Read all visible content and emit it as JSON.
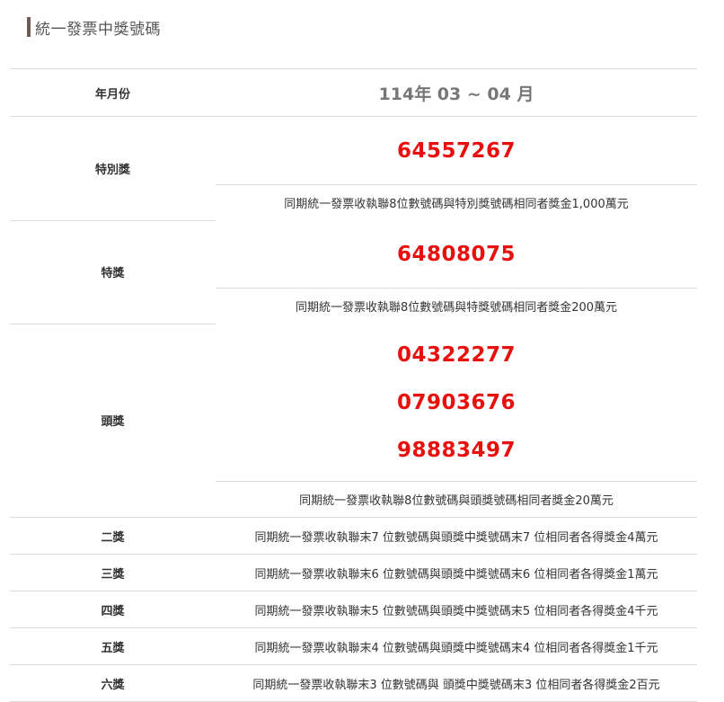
{
  "page": {
    "title": "統一發票中獎號碼"
  },
  "period": {
    "label": "年月份",
    "value": "114年 03 ~ 04 月"
  },
  "prizes": {
    "special": {
      "label": "特別獎",
      "numbers": [
        "64557267"
      ],
      "desc": "同期統一發票收執聯8位數號碼與特別獎號碼相同者獎金1,000萬元"
    },
    "grand": {
      "label": "特獎",
      "numbers": [
        "64808075"
      ],
      "desc": "同期統一發票收執聯8位數號碼與特獎號碼相同者獎金200萬元"
    },
    "first": {
      "label": "頭獎",
      "numbers": [
        "04322277",
        "07903676",
        "98883497"
      ],
      "desc": "同期統一發票收執聯8位數號碼與頭獎號碼相同者獎金20萬元"
    },
    "second": {
      "label": "二獎",
      "desc": "同期統一發票收執聯末7 位數號碼與頭獎中獎號碼末7 位相同者各得獎金4萬元"
    },
    "third": {
      "label": "三獎",
      "desc": "同期統一發票收執聯末6 位數號碼與頭獎中獎號碼末6 位相同者各得獎金1萬元"
    },
    "fourth": {
      "label": "四獎",
      "desc": "同期統一發票收執聯末5 位數號碼與頭獎中獎號碼末5 位相同者各得獎金4千元"
    },
    "fifth": {
      "label": "五獎",
      "desc": "同期統一發票收執聯末4 位數號碼與頭獎中獎號碼末4 位相同者各得獎金1千元"
    },
    "sixth": {
      "label": "六獎",
      "desc": "同期統一發票收執聯末3 位數號碼與 頭獎中獎號碼末3 位相同者各得獎金2百元"
    }
  },
  "colors": {
    "number": "#e8100f",
    "header_bar": "#6b5a55",
    "border": "#dcdcdc"
  }
}
